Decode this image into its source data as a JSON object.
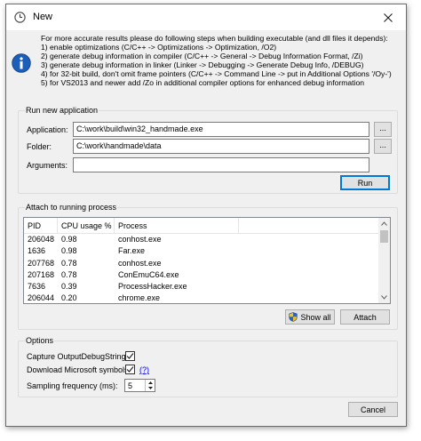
{
  "window": {
    "title": "New",
    "icon": "clock-icon"
  },
  "info": {
    "icon": "info-icon",
    "lines": [
      "For more accurate results please do following steps when building executable (and dll files it depends):",
      "1) enable optimizations (C/C++ -> Optimizations -> Optimization, /O2)",
      "2) generate debug information in compiler (C/C++ -> General -> Debug Information Format, /Zi)",
      "3) generate debug information in linker (Linker -> Debugging -> Generate Debug Info, /DEBUG)",
      "4) for 32-bit build, don't omit frame pointers (C/C++ -> Command Line -> put in Additional Options '/Oy-')",
      "5) for VS2013 and newer add /Zo in additional compiler options for enhanced debug information"
    ]
  },
  "run_new": {
    "legend": "Run new application",
    "application_label": "Application:",
    "application_value": "C:\\work\\build\\win32_handmade.exe",
    "folder_label": "Folder:",
    "folder_value": "C:\\work\\handmade\\data",
    "arguments_label": "Arguments:",
    "arguments_value": "",
    "browse_label": "...",
    "run_label": "Run"
  },
  "attach": {
    "legend": "Attach to running process",
    "columns": [
      "PID",
      "CPU usage %",
      "Process"
    ],
    "rows": [
      [
        "206048",
        "0.98",
        "conhost.exe"
      ],
      [
        "1636",
        "0.98",
        "Far.exe"
      ],
      [
        "207768",
        "0.78",
        "conhost.exe"
      ],
      [
        "207168",
        "0.78",
        "ConEmuC64.exe"
      ],
      [
        "7636",
        "0.39",
        "ProcessHacker.exe"
      ],
      [
        "206044",
        "0.20",
        "chrome.exe"
      ]
    ],
    "show_all_label": "Show all",
    "attach_label": "Attach"
  },
  "options": {
    "legend": "Options",
    "capture_label": "Capture OutputDebugString:",
    "capture_checked": true,
    "download_label": "Download Microsoft symbols:",
    "download_checked": true,
    "help_link": "(?)",
    "sampling_label": "Sampling frequency (ms):",
    "sampling_value": "5"
  },
  "cancel_label": "Cancel",
  "colors": {
    "accent": "#0078d7",
    "info_blue": "#1c5fb8",
    "link": "#0000ee"
  }
}
